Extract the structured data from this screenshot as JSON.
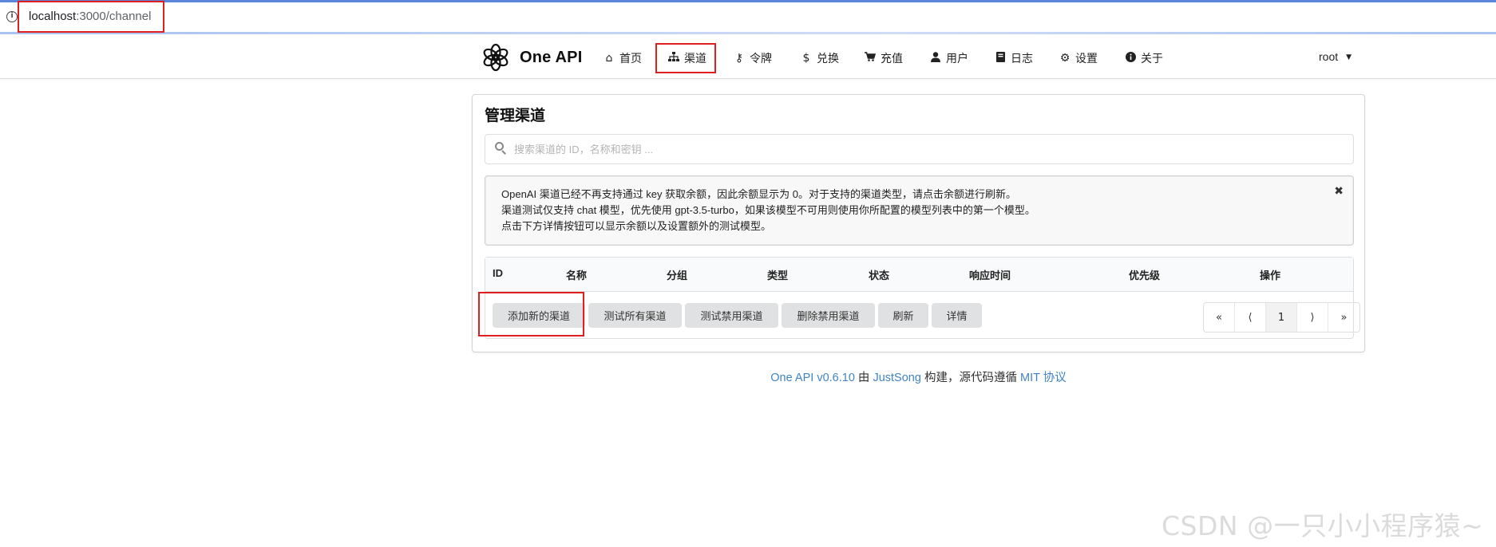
{
  "browser": {
    "url_host": "localhost",
    "url_path": ":3000/channel"
  },
  "nav": {
    "brand": "One API",
    "items": [
      {
        "icon": "home-icon",
        "label": "首页"
      },
      {
        "icon": "sitemap-icon",
        "label": "渠道"
      },
      {
        "icon": "key-icon",
        "label": "令牌"
      },
      {
        "icon": "dollar-icon",
        "label": "兑换"
      },
      {
        "icon": "cart-icon",
        "label": "充值"
      },
      {
        "icon": "user-icon",
        "label": "用户"
      },
      {
        "icon": "book-icon",
        "label": "日志"
      },
      {
        "icon": "gear-icon",
        "label": "设置"
      },
      {
        "icon": "info-icon",
        "label": "关于"
      }
    ],
    "user": "root"
  },
  "page": {
    "title": "管理渠道",
    "search_placeholder": "搜索渠道的 ID，名称和密钥 ...",
    "notice": [
      "OpenAI 渠道已经不再支持通过 key 获取余额，因此余额显示为 0。对于支持的渠道类型，请点击余额进行刷新。",
      "渠道测试仅支持 chat 模型，优先使用 gpt-3.5-turbo，如果该模型不可用则使用你所配置的模型列表中的第一个模型。",
      "点击下方详情按钮可以显示余额以及设置额外的测试模型。"
    ],
    "notice_close": "✖",
    "columns": [
      "ID",
      "名称",
      "分组",
      "类型",
      "状态",
      "响应时间",
      "优先级",
      "操作"
    ],
    "buttons": [
      "添加新的渠道",
      "测试所有渠道",
      "测试禁用渠道",
      "删除禁用渠道",
      "刷新",
      "详情"
    ],
    "pager": [
      "«",
      "⟨",
      "1",
      "⟩",
      "»"
    ]
  },
  "footer": {
    "version": "One API v0.6.10",
    "by": " 由 ",
    "author": "JustSong",
    "built": " 构建，源代码遵循 ",
    "license": "MIT 协议"
  },
  "watermark": "CSDN @一只小小程序猿~",
  "colors": {
    "link": "#4183c4",
    "highlight": "#e02020",
    "button_bg": "#e0e1e2"
  }
}
